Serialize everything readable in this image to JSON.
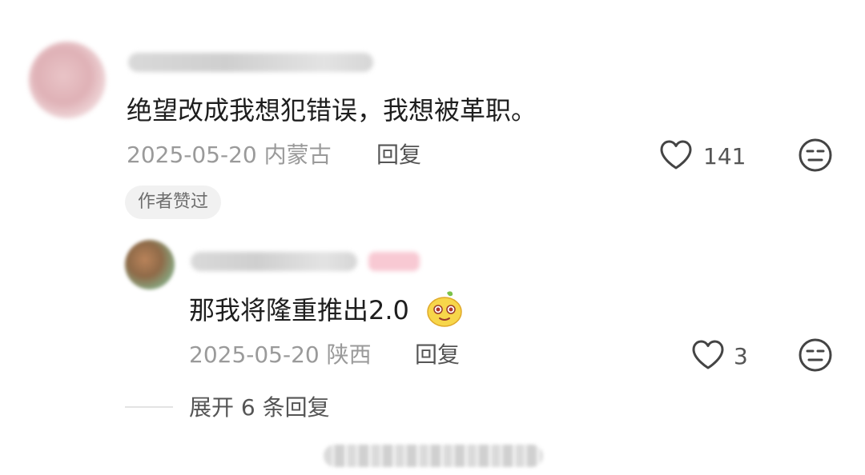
{
  "comment": {
    "text": "绝望改成我想犯错误，我想被革职。",
    "date": "2025-05-20",
    "location": "内蒙古",
    "reply_label": "回复",
    "like_count": "141",
    "author_liked_badge": "作者赞过"
  },
  "reply": {
    "text": "那我将隆重推出2.0",
    "date": "2025-05-20",
    "location": "陕西",
    "reply_label": "回复",
    "like_count": "3"
  },
  "expand": {
    "label": "展开 6 条回复"
  },
  "icons": {
    "like": "heart-outline-icon",
    "dislike": "neutral-face-icon",
    "emoji": "yellow-character-emoji"
  },
  "colors": {
    "text_primary": "#1e1e1e",
    "text_secondary": "#9a9a9a",
    "action_text": "#555555",
    "badge_bg": "#f1f1f1"
  }
}
